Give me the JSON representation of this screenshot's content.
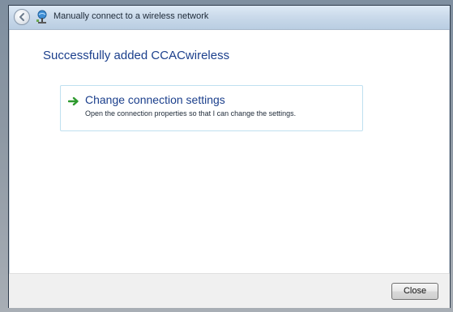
{
  "window": {
    "title": "Manually connect to a wireless network"
  },
  "heading": "Successfully added CCACwireless",
  "option": {
    "title": "Change connection settings",
    "description": "Open the connection properties so that I can change the settings.",
    "icon": "green-arrow-icon"
  },
  "footer": {
    "close_label": "Close"
  },
  "icons": {
    "back": "back-arrow-icon",
    "network": "network-icon"
  },
  "colors": {
    "heading": "#1b3f8c",
    "option_border": "#bfe0f0",
    "arrow": "#2e9a2e"
  }
}
